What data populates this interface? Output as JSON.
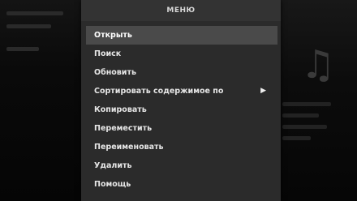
{
  "menu": {
    "title": "МЕНЮ",
    "items": [
      {
        "label": "Открыть",
        "selected": true,
        "has_submenu": false
      },
      {
        "label": "Поиск",
        "selected": false,
        "has_submenu": false
      },
      {
        "label": "Обновить",
        "selected": false,
        "has_submenu": false
      },
      {
        "label": "Сортировать содержимое по",
        "selected": false,
        "has_submenu": true
      },
      {
        "label": "Копировать",
        "selected": false,
        "has_submenu": false
      },
      {
        "label": "Переместить",
        "selected": false,
        "has_submenu": false
      },
      {
        "label": "Переименовать",
        "selected": false,
        "has_submenu": false
      },
      {
        "label": "Удалить",
        "selected": false,
        "has_submenu": false
      },
      {
        "label": "Помощь",
        "selected": false,
        "has_submenu": false
      }
    ],
    "submenu_arrow_icon": "triangle-right-icon"
  },
  "background": {
    "right_icon": "music-note-icon"
  },
  "colors": {
    "menu_background": "#2b2b2b",
    "selection": "#4a4a4a",
    "text": "#e6e6e6"
  }
}
